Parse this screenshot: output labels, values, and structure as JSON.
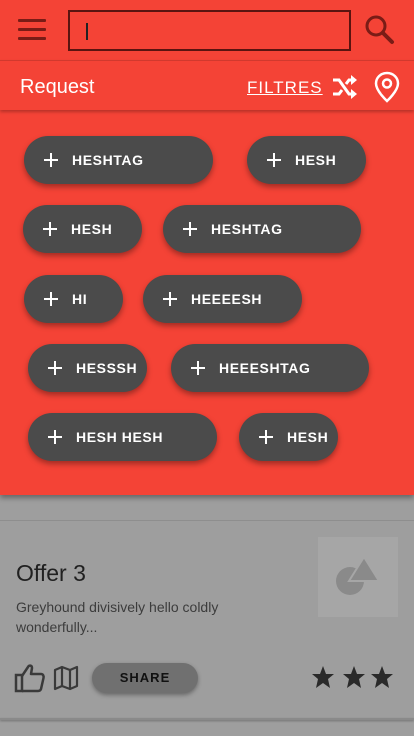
{
  "search": {
    "value": ""
  },
  "request_bar": {
    "title": "Request",
    "filters_label": "FILTRES"
  },
  "chips": [
    {
      "label": "HESHTAG"
    },
    {
      "label": "HESH"
    },
    {
      "label": "HESH"
    },
    {
      "label": "HESHTAG"
    },
    {
      "label": "HI"
    },
    {
      "label": "HEEEESH"
    },
    {
      "label": "HESSSH"
    },
    {
      "label": "HEEESHTAG"
    },
    {
      "label": "HESH HESH"
    },
    {
      "label": "HESH"
    }
  ],
  "offer": {
    "title": "Offer 3",
    "description": "Greyhound divisively hello coldly wonderfully...",
    "share_label": "SHARE",
    "rating": 3
  },
  "colors": {
    "primary": "#f44336",
    "chip": "#4b4b4b",
    "background": "#9e9e9e"
  },
  "icons": [
    "menu-icon",
    "search-icon",
    "shuffle-icon",
    "location-pin-icon",
    "plus-icon",
    "image-placeholder-icon",
    "thumbs-up-icon",
    "map-icon",
    "star-icon"
  ]
}
